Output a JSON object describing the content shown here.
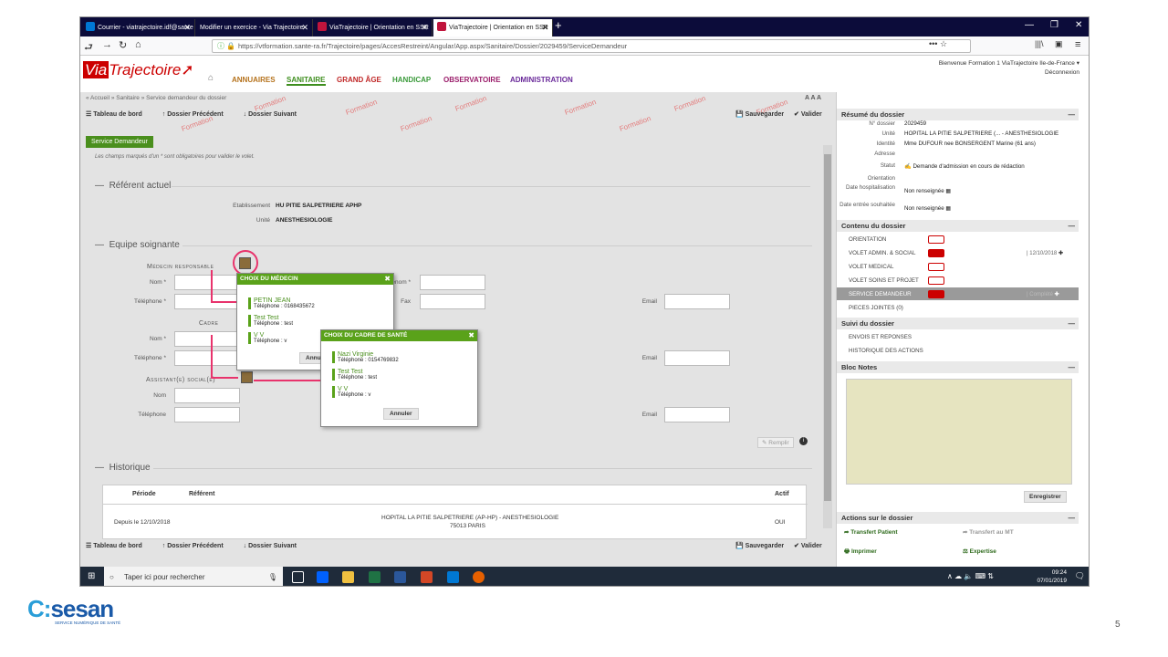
{
  "browser": {
    "tabs": [
      {
        "label": "Courrier - viatrajectoire.idf@sante",
        "active": false,
        "color": "#0078d4"
      },
      {
        "label": "Modifier un exercice - Via Trajectoire",
        "active": false,
        "color": "#555555"
      },
      {
        "label": "ViaTrajectoire | Orientation en SSR",
        "active": false,
        "color": "#c0143c"
      },
      {
        "label": "ViaTrajectoire | Orientation en SSR",
        "active": true,
        "color": "#c0143c"
      }
    ],
    "url": "https://vtformation.sante-ra.fr/Trajectoire/pages/AccesRestreint/Angular/App.aspx/Sanitaire/Dossier/2029459/ServiceDemandeur"
  },
  "app": {
    "menu": [
      {
        "label": "ANNUAIRES",
        "color": "#b5721c"
      },
      {
        "label": "SANITAIRE",
        "color": "#3e8e1e"
      },
      {
        "label": "GRAND ÂGE",
        "color": "#c02828"
      },
      {
        "label": "HANDICAP",
        "color": "#3a9a3a"
      },
      {
        "label": "OBSERVATOIRE",
        "color": "#9a1c6a"
      },
      {
        "label": "ADMINISTRATION",
        "color": "#6a2a9a"
      }
    ],
    "user_line": "Bienvenue Formation 1 ViaTrajectoire Ile-de-France",
    "logout": "Déconnexion",
    "breadcrumb": "« Accueil » Sanitaire » Service demandeur du dossier",
    "text_size": "A A A",
    "watermark": "Formation"
  },
  "toolbar": {
    "tableau": "Tableau de bord",
    "precedent": "Dossier Précédent",
    "suivant": "Dossier Suivant",
    "sauvegarder": "Sauvegarder",
    "valider": "Valider"
  },
  "form": {
    "tab": "Service Demandeur",
    "note": "Les champs marqués d'un * sont obligatoires pour valider le volet.",
    "referent_title": "Référent actuel",
    "etab_label": "Etablissement",
    "etab_value": "HU PITIE SALPETRIERE APHP",
    "unite_label": "Unité",
    "unite_value": "ANESTHESIOLOGIE",
    "equipe_title": "Equipe soignante",
    "medecin_label": "Médecin responsable",
    "cadre_label": "Cadre",
    "assistant_label": "Assistant(e) social(e)",
    "nom_req": "Nom *",
    "tel_req": "Téléphone *",
    "nom": "Nom",
    "tel": "Téléphone",
    "prenom_req": "Prénom *",
    "fax": "Fax",
    "email": "Email",
    "remplir": "Remplir",
    "historique_title": "Historique",
    "hist_headers": [
      "Période",
      "Référent",
      "Actif"
    ],
    "hist_row": {
      "periode": "Depuis le 12/10/2018",
      "referent": "HOPITAL LA PITIE SALPETRIERE (AP-HP) - ANESTHESIOLOGIE",
      "ville": "75013 PARIS",
      "actif": "OUI"
    }
  },
  "popup_medecin": {
    "title": "CHOIX DU MÉDECIN",
    "items": [
      {
        "name": "PETIN JEAN",
        "tel": "Téléphone : 0168435672"
      },
      {
        "name": "Test Test",
        "tel": "Téléphone : test"
      },
      {
        "name": "V V",
        "tel": "Téléphone : v"
      }
    ],
    "cancel": "Annuler"
  },
  "popup_cadre": {
    "title": "CHOIX DU CADRE DE SANTÉ",
    "items": [
      {
        "name": "Nazi Virginie",
        "tel": "Téléphone : 0154769832"
      },
      {
        "name": "Test Test",
        "tel": "Téléphone : test"
      },
      {
        "name": "V V",
        "tel": "Téléphone : v"
      }
    ],
    "cancel": "Annuler"
  },
  "resume": {
    "title": "Résumé du dossier",
    "rows": [
      {
        "k": "N° dossier",
        "v": "2029459"
      },
      {
        "k": "Unité",
        "v": "HOPITAL LA PITIE SALPETRIERE (... - ANESTHESIOLOGIE"
      },
      {
        "k": "Identité",
        "v": "Mme DUFOUR nee BONSERGENT Marine (61 ans)"
      },
      {
        "k": "Adresse",
        "v": ""
      },
      {
        "k": "Statut",
        "v": "Demande d'admission en cours de rédaction"
      },
      {
        "k": "Orientation",
        "v": ""
      },
      {
        "k": "Date hospitalisation",
        "v": "Non renseignée"
      },
      {
        "k": "Date entrée souhaitée",
        "v": "Non renseignée"
      }
    ]
  },
  "contenu": {
    "title": "Contenu du dossier",
    "items": [
      "ORIENTATION",
      "VOLET ADMIN. & SOCIAL",
      "VOLET MEDICAL",
      "VOLET SOINS ET PROJET",
      "SERVICE DEMANDEUR",
      "PIECES JOINTES (0)"
    ],
    "date": "12/10/2018",
    "complete": "Complété"
  },
  "suivi": {
    "title": "Suivi du dossier",
    "items": [
      "ENVOIS ET REPONSES",
      "HISTORIQUE DES ACTIONS"
    ]
  },
  "bloc": {
    "title": "Bloc Notes",
    "save": "Enregistrer"
  },
  "actions": {
    "title": "Actions sur le dossier",
    "transfert": "Transfert Patient",
    "transfert_mt": "Transfert au MT",
    "imprimer": "Imprimer",
    "expertise": "Expertise"
  },
  "taskbar": {
    "search": "Taper ici pour rechercher",
    "time": "09:24",
    "date": "07/01/2019"
  },
  "slide": {
    "logo_main": "sesan",
    "logo_sub": "SERVICE NUMÉRIQUE DE SANTÉ",
    "page": "5"
  }
}
